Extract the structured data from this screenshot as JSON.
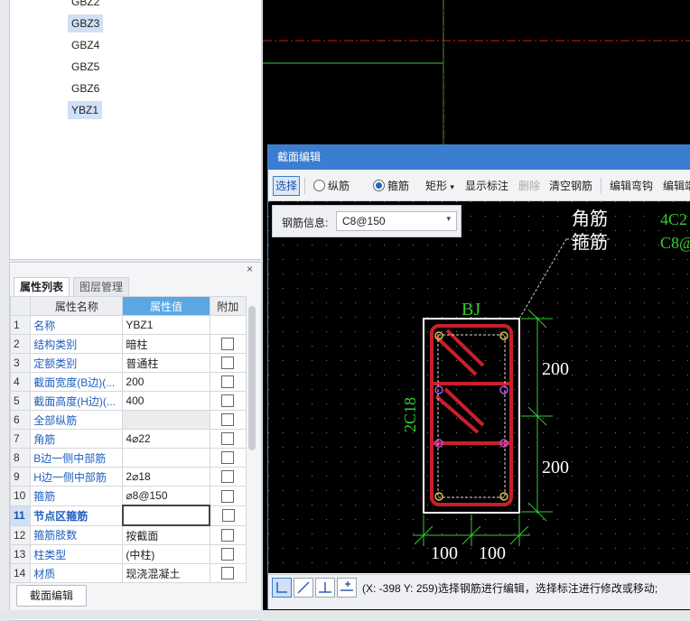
{
  "tree": {
    "items": [
      {
        "label": "GBZ2",
        "selected": false
      },
      {
        "label": "GBZ3",
        "selected": true
      },
      {
        "label": "GBZ4",
        "selected": false
      },
      {
        "label": "GBZ5",
        "selected": false
      },
      {
        "label": "GBZ6",
        "selected": false
      },
      {
        "label": "YBZ1",
        "selected": true
      }
    ]
  },
  "props": {
    "close_icon": "×",
    "tabs": [
      "属性列表",
      "图层管理"
    ],
    "headers": [
      "属性名称",
      "属性值",
      "附加"
    ],
    "rows": [
      {
        "num": "1",
        "name": "名称",
        "value": "YBZ1",
        "check": false
      },
      {
        "num": "2",
        "name": "结构类别",
        "value": "暗柱",
        "check": true
      },
      {
        "num": "3",
        "name": "定额类别",
        "value": "普通柱",
        "check": true
      },
      {
        "num": "4",
        "name": "截面宽度(B边)(...",
        "value": "200",
        "check": true
      },
      {
        "num": "5",
        "name": "截面高度(H边)(...",
        "value": "400",
        "check": true
      },
      {
        "num": "6",
        "name": "全部纵筋",
        "value": "",
        "check": true
      },
      {
        "num": "7",
        "name": "角筋",
        "value": "4⌀22",
        "check": true
      },
      {
        "num": "8",
        "name": "B边一侧中部筋",
        "value": "",
        "check": true
      },
      {
        "num": "9",
        "name": "H边一侧中部筋",
        "value": "2⌀18",
        "check": true
      },
      {
        "num": "10",
        "name": "箍筋",
        "value": "⌀8@150",
        "check": true
      },
      {
        "num": "11",
        "name": "节点区箍筋",
        "value": "",
        "check": true
      },
      {
        "num": "12",
        "name": "箍筋肢数",
        "value": "按截面",
        "check": true
      },
      {
        "num": "13",
        "name": "柱类型",
        "value": "(中柱)",
        "check": true
      },
      {
        "num": "14",
        "name": "材质",
        "value": "现浇混凝土",
        "check": true
      }
    ],
    "edit_button": "截面编辑"
  },
  "dialog": {
    "title": "截面编辑",
    "toolbar": {
      "select": "选择",
      "longitudinal": "纵筋",
      "stirrup": "箍筋",
      "rect": "矩形",
      "rect_arrow": "▾",
      "show_label": "显示标注",
      "delete": "删除",
      "clear": "清空钢筋",
      "edit_hook": "编辑弯钩",
      "edit_more": "编辑端"
    },
    "info_label": "钢筋信息:",
    "info_value": "C8@150",
    "info_arrow": "▾",
    "canvas": {
      "corner_label": "角筋",
      "corner_value": "4C2",
      "stirrup_label": "箍筋",
      "stirrup_value": "C8@",
      "bj": "BJ",
      "side": "2C18",
      "dim_top": "200",
      "dim_bottom": "200",
      "dim_left": "100",
      "dim_right": "100"
    },
    "status": "(X: -398 Y: 259)选择钢筋进行编辑，选择标注进行修改或移动;"
  },
  "colors": {
    "rebar": "#c8202a",
    "dim": "#33cc33",
    "accent": "#3b7dd0"
  }
}
